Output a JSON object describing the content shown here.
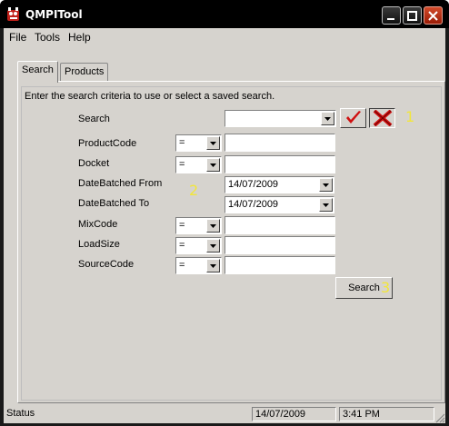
{
  "window": {
    "title": "QMPITool"
  },
  "menu": {
    "items": [
      "File",
      "Tools",
      "Help"
    ]
  },
  "tabs": [
    {
      "label": "Search",
      "active": true
    },
    {
      "label": "Products",
      "active": false
    }
  ],
  "search_panel": {
    "instructions": "Enter the search criteria to use or select a saved search.",
    "saved_search": {
      "label": "Search",
      "value": ""
    },
    "fields": [
      {
        "label": "ProductCode",
        "operator": "=",
        "value": ""
      },
      {
        "label": "Docket",
        "operator": "=",
        "value": ""
      },
      {
        "label": "DateBatched From",
        "date": "14/07/2009"
      },
      {
        "label": "DateBatched To",
        "date": "14/07/2009"
      },
      {
        "label": "MixCode",
        "operator": "=",
        "value": ""
      },
      {
        "label": "LoadSize",
        "operator": "=",
        "value": ""
      },
      {
        "label": "SourceCode",
        "operator": "=",
        "value": ""
      }
    ],
    "search_button": "Search",
    "annotations": [
      "1",
      "2",
      "3"
    ]
  },
  "statusbar": {
    "status": "Status",
    "date": "14/07/2009",
    "time": "3:41 PM"
  },
  "colors": {
    "accept_icon": "#d01010",
    "clear_icon": "#d01010",
    "annotation": "#f2e63a"
  }
}
